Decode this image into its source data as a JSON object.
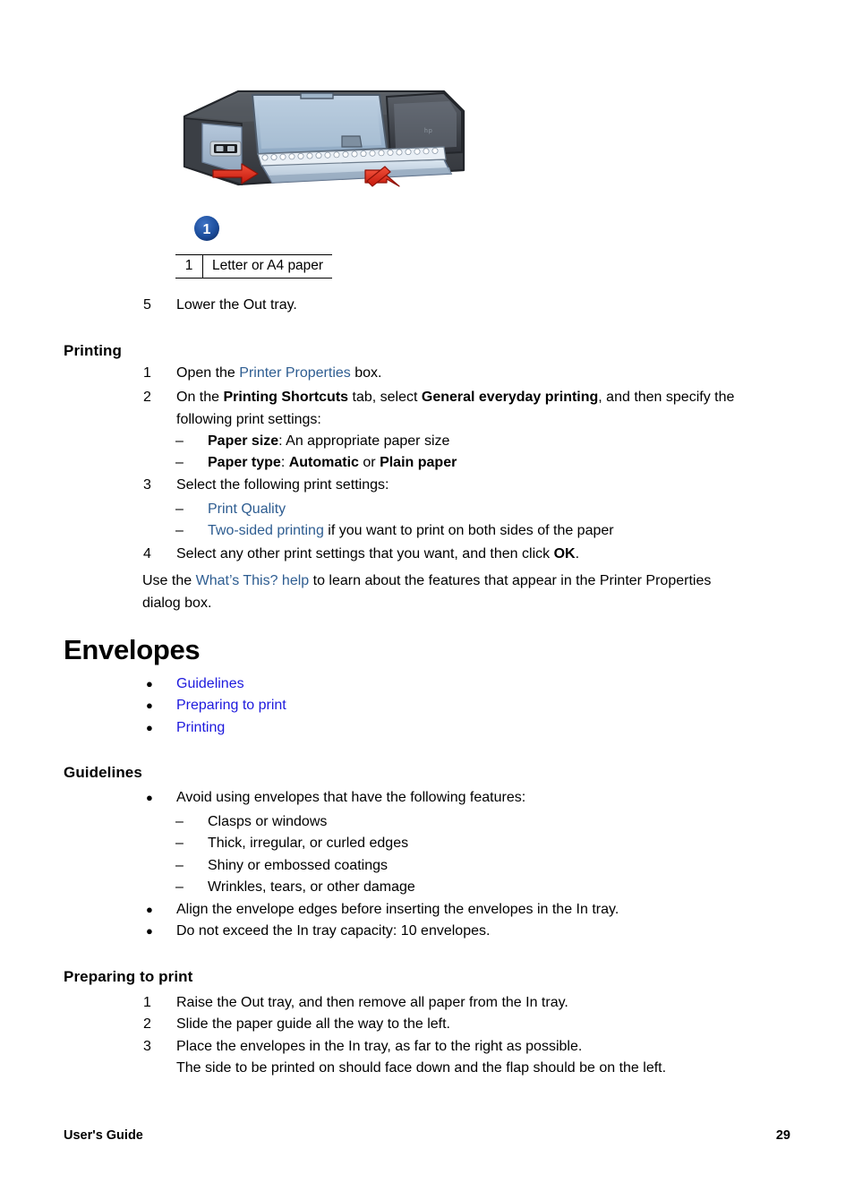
{
  "figure": {
    "alt_name": "printer-loading-paper-illustration",
    "callout_label": "1",
    "caption": {
      "number": "1",
      "text": "Letter or A4 paper"
    }
  },
  "step5": {
    "num": "5",
    "text": "Lower the Out tray."
  },
  "printing_section": {
    "heading": "Printing",
    "steps": [
      {
        "num": "1",
        "pre": "Open the ",
        "link": "Printer Properties",
        "post": " box."
      },
      {
        "num": "2",
        "seg1": "On the ",
        "bold1": "Printing Shortcuts",
        "seg2": " tab, select ",
        "bold2": "General everyday printing",
        "seg3": ", and then specify the following print settings:"
      },
      {
        "num": "3",
        "text": "Select the following print settings:"
      },
      {
        "num": "4",
        "pre": "Select any other print settings that you want, and then click ",
        "bold": "OK",
        "post": "."
      }
    ],
    "sub_step2": [
      {
        "dash": "–",
        "bold": "Paper size",
        "rest": ": An appropriate paper size"
      },
      {
        "dash": "–",
        "bold": "Paper type",
        "rest": ": ",
        "bold2": "Automatic",
        "mid": " or ",
        "bold3": "Plain paper"
      }
    ],
    "sub_step3": [
      {
        "dash": "–",
        "link": "Print Quality",
        "rest": ""
      },
      {
        "dash": "–",
        "link": "Two-sided printing",
        "rest": " if you want to print on both sides of the paper"
      }
    ],
    "closing": {
      "pre": "Use the ",
      "link": "What’s This? help",
      "post": " to learn about the features that appear in the Printer Properties dialog box."
    }
  },
  "envelopes_section": {
    "heading": "Envelopes",
    "toc_bullet": "●",
    "toc_links": [
      "Guidelines",
      "Preparing to print",
      "Printing"
    ]
  },
  "guidelines_section": {
    "heading": "Guidelines",
    "bullet": "●",
    "dash": "–",
    "items": [
      "Avoid using envelopes that have the following features:",
      "Align the envelope edges before inserting the envelopes in the In tray.",
      "Do not exceed the In tray capacity: 10 envelopes."
    ],
    "sub_items": [
      "Clasps or windows",
      "Thick, irregular, or curled edges",
      "Shiny or embossed coatings",
      "Wrinkles, tears, or other damage"
    ]
  },
  "preparing_section": {
    "heading": "Preparing to print",
    "steps": [
      {
        "num": "1",
        "text": "Raise the Out tray, and then remove all paper from the In tray."
      },
      {
        "num": "2",
        "text": "Slide the paper guide all the way to the left."
      },
      {
        "num": "3",
        "text": "Place the envelopes in the In tray, as far to the right as possible."
      }
    ],
    "step3_continuation": "The side to be printed on should face down and the flap should be on the left."
  },
  "footer": {
    "left": "User's Guide",
    "page_number": "29"
  },
  "colors": {
    "link_dark": "#2e5d91",
    "link_bright": "#1d19dd",
    "callout_blue": "#1b4a9c",
    "arrow_red": "#e02b18",
    "text": "#000000",
    "page_background": "#ffffff"
  }
}
